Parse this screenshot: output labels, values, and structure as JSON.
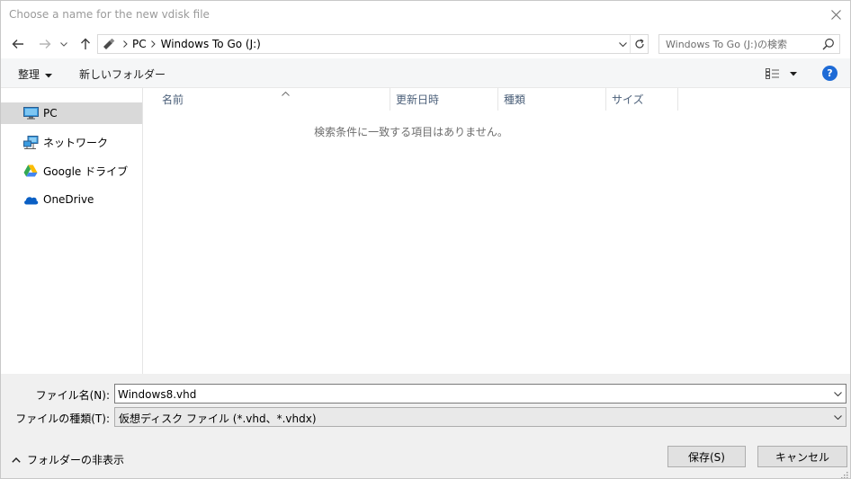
{
  "window": {
    "title": "Choose a name for the new vdisk file"
  },
  "address": {
    "breadcrumbs": [
      "PC",
      "Windows To Go (J:)"
    ],
    "search_placeholder": "Windows To Go (J:)の検索"
  },
  "toolbar": {
    "organize_label": "整理",
    "new_folder_label": "新しいフォルダー"
  },
  "sidebar": {
    "items": [
      {
        "label": "PC",
        "icon": "pc-icon",
        "selected": true
      },
      {
        "label": "ネットワーク",
        "icon": "network-icon",
        "selected": false
      },
      {
        "label": "Google ドライブ",
        "icon": "google-drive-icon",
        "selected": false
      },
      {
        "label": "OneDrive",
        "icon": "onedrive-icon",
        "selected": false
      }
    ]
  },
  "file_list": {
    "columns": [
      "名前",
      "更新日時",
      "種類",
      "サイズ"
    ],
    "empty_message": "検索条件に一致する項目はありません。"
  },
  "footer": {
    "filename_label": "ファイル名(N):",
    "filename_value": "Windows8.vhd",
    "filetype_label": "ファイルの種類(T):",
    "filetype_value": "仮想ディスク ファイル (*.vhd、*.vhdx)",
    "hide_folders_label": "フォルダーの非表示",
    "save_label": "保存(S)",
    "cancel_label": "キャンセル"
  },
  "colors": {
    "accent": "#1e6bd6",
    "selection": "#d9d9d9",
    "header_text": "#4c607a"
  }
}
